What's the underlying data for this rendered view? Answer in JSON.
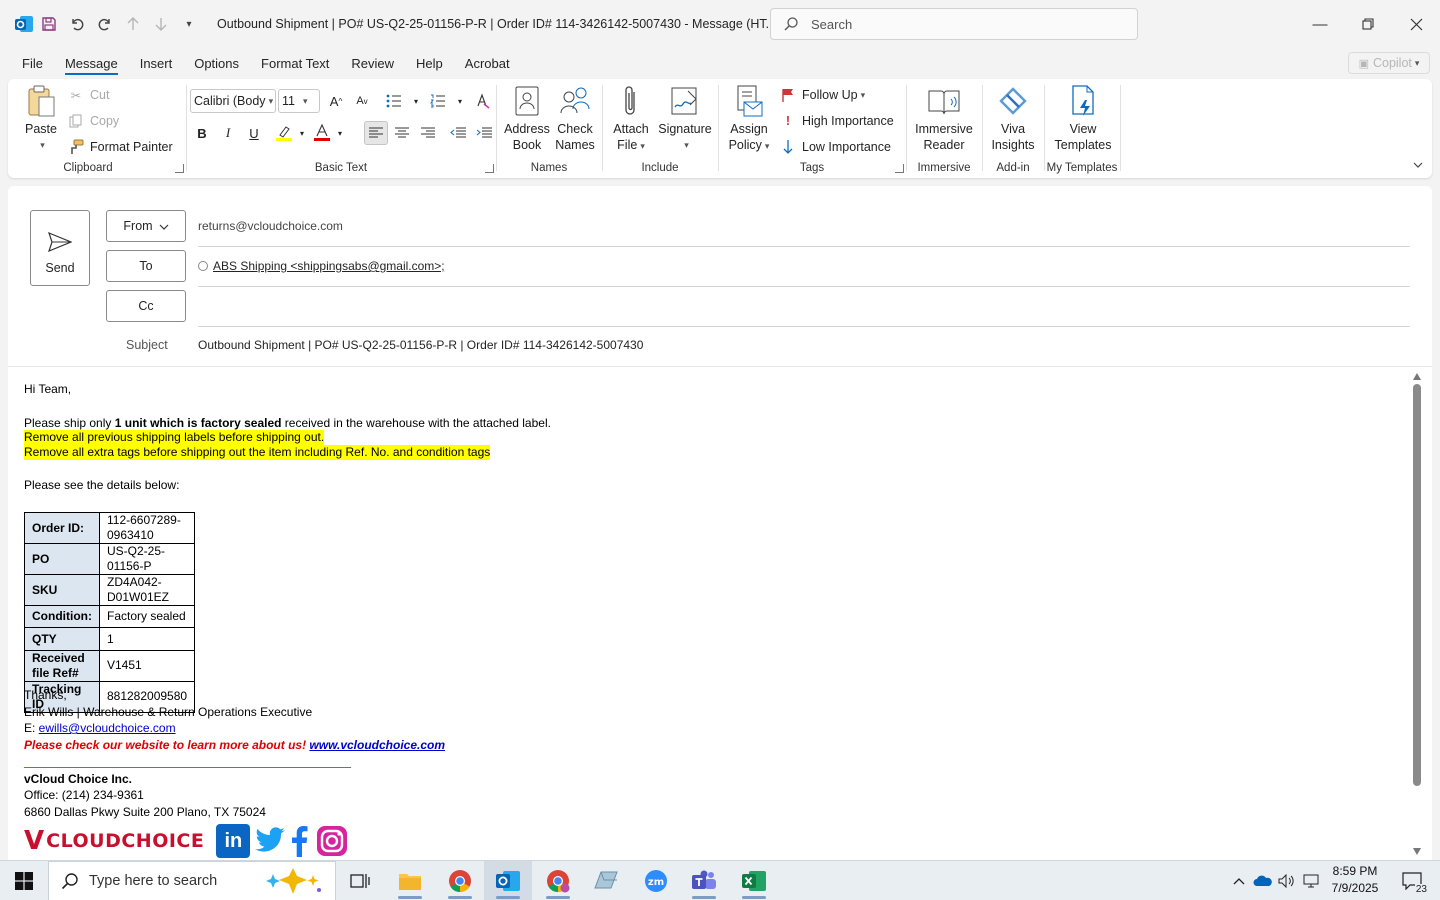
{
  "window": {
    "title": "Outbound Shipment | PO# US-Q2-25-01156-P-R | Order ID# 114-3426142-5007430  -  Message (HT...",
    "search_placeholder": "Search"
  },
  "menu": {
    "tabs": [
      "File",
      "Message",
      "Insert",
      "Options",
      "Format Text",
      "Review",
      "Help",
      "Acrobat"
    ],
    "active": "Message",
    "copilot_label": "Copilot"
  },
  "ribbon": {
    "clipboard": {
      "label": "Clipboard",
      "paste": "Paste",
      "cut": "Cut",
      "copy": "Copy",
      "format_painter": "Format Painter"
    },
    "basic_text": {
      "label": "Basic Text",
      "font_name": "Calibri (Body",
      "font_size": "11"
    },
    "names": {
      "label": "Names",
      "address_book_1": "Address",
      "address_book_2": "Book",
      "check_names_1": "Check",
      "check_names_2": "Names"
    },
    "include": {
      "label": "Include",
      "attach_1": "Attach",
      "attach_2": "File",
      "signature": "Signature"
    },
    "tags": {
      "label": "Tags",
      "assign_1": "Assign",
      "assign_2": "Policy",
      "follow_up": "Follow Up",
      "high": "High Importance",
      "low": "Low Importance"
    },
    "immersive": {
      "label": "Immersive",
      "btn_1": "Immersive",
      "btn_2": "Reader"
    },
    "addin": {
      "label": "Add-in",
      "btn_1": "Viva",
      "btn_2": "Insights"
    },
    "templates": {
      "label": "My Templates",
      "btn_1": "View",
      "btn_2": "Templates"
    }
  },
  "header": {
    "send": "Send",
    "from_label": "From",
    "from_value": "returns@vcloudchoice.com",
    "to_label": "To",
    "to_value": "ABS Shipping <shippingsabs@gmail.com>;",
    "cc_label": "Cc",
    "subject_label": "Subject",
    "subject_value": "Outbound Shipment | PO# US-Q2-25-01156-P-R | Order ID# 114-3426142-5007430"
  },
  "body": {
    "greeting": "Hi Team,",
    "instr_pre": "Please ship only ",
    "instr_bold": "1 unit which is factory sealed",
    "instr_post": " received in the warehouse with the attached label.",
    "hl1": "Remove all previous shipping labels before shipping out.",
    "hl2": "Remove all extra tags before shipping out the item including Ref. No. and condition tags",
    "details_intro": "Please see the details below:",
    "details": [
      {
        "k": "Order ID:",
        "v": "112-6607289-0963410"
      },
      {
        "k": "PO",
        "v": "US-Q2-25-01156-P"
      },
      {
        "k": "SKU",
        "v": "ZD4A042-D01W01EZ"
      },
      {
        "k": "Condition:",
        "v": "Factory sealed"
      },
      {
        "k": "QTY",
        "v": "1"
      },
      {
        "k": "Received file Ref#",
        "v": "V1451"
      },
      {
        "k": "Tracking ID",
        "v": "881282009580"
      }
    ],
    "thanks": "Thanks,",
    "sig_name": "Erik Wills | Warehouse & Return Operations Executive",
    "sig_email_label": "E: ",
    "sig_email": "ewills@vcloudchoice.com",
    "promo": "Please check our website to learn more about us! ",
    "promo_link": "www.vcloudchoice.com",
    "company": "vCloud Choice Inc.",
    "office": "Office: (214) 234-9361",
    "address": "6860 Dallas Pkwy Suite 200 Plano, TX 75024",
    "logo_text": "CLOUDCHOICE",
    "logo_letter": "V"
  },
  "taskbar": {
    "search_placeholder": "Type here to search",
    "time": "8:59 PM",
    "date": "7/9/2025",
    "notifications": "23"
  },
  "colors": {
    "accent": "#0f6cbd",
    "highlight": "#ffff00",
    "table_key_bg": "#dce6f1",
    "promo_red": "#e00000",
    "link_blue": "#0000cc"
  }
}
